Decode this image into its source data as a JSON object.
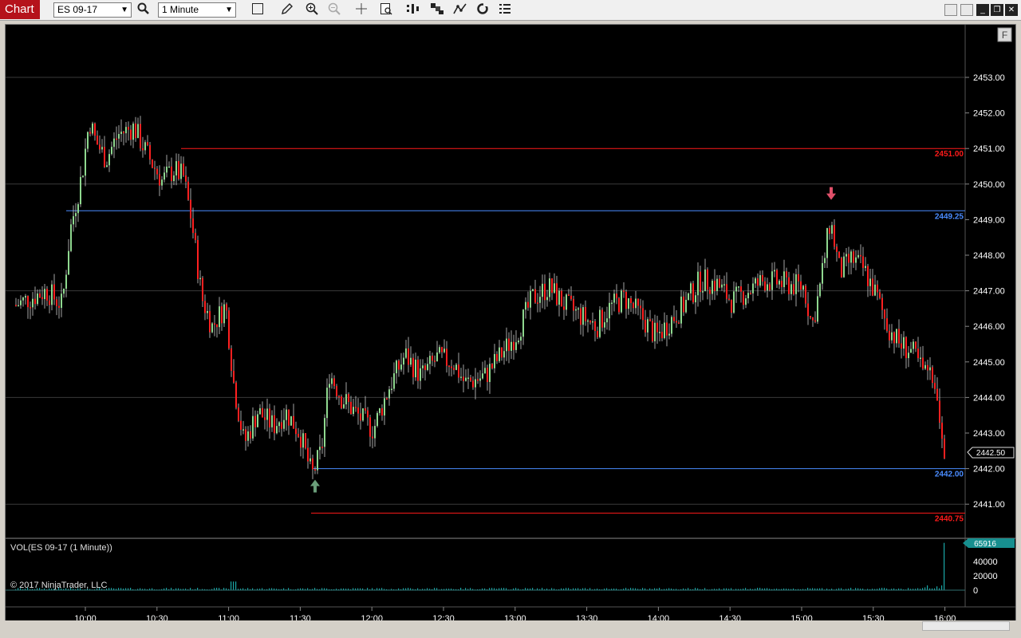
{
  "toolbar": {
    "chart_tab": "Chart",
    "instrument": "ES 09-17",
    "interval": "1 Minute",
    "icons": [
      "instrument-search-icon",
      "bar-style-icon",
      "draw-pencil-icon",
      "zoom-in-icon",
      "zoom-out-icon",
      "crosshair-icon",
      "data-box-icon",
      "strategies-icon",
      "chart-trader-icon",
      "indicators-icon",
      "refresh-icon",
      "properties-icon"
    ]
  },
  "window_buttons": [
    "restore-left",
    "restore-right",
    "minimize",
    "maximize",
    "close"
  ],
  "price_chart": {
    "f_button": "F",
    "price_axis_labels": [
      "2453.00",
      "2452.00",
      "2451.00",
      "2450.00",
      "2449.00",
      "2448.00",
      "2447.00",
      "2446.00",
      "2445.00",
      "2444.00",
      "2443.00",
      "2442.00",
      "2441.00"
    ],
    "level_labels": [
      {
        "text": "2451.00",
        "color": "#ff1a1a"
      },
      {
        "text": "2449.25",
        "color": "#4a8cff"
      },
      {
        "text": "2442.00",
        "color": "#4a8cff"
      },
      {
        "text": "2440.75",
        "color": "#ff1a1a"
      }
    ],
    "last_price": "2442.50",
    "up_color": "#8fd88f",
    "down_color": "#ff2020",
    "signal_up_color": "#6a9e7a",
    "signal_down_color": "#e0506a"
  },
  "volume_panel": {
    "title": "VOL(ES 09-17 (1 Minute))",
    "copyright": "© 2017 NinjaTrader, LLC",
    "axis_labels": [
      "40000",
      "20000",
      "0"
    ],
    "last_volume": "65916",
    "bar_color": "#1aa7a7"
  },
  "time_axis": [
    "10:00",
    "10:30",
    "11:00",
    "11:30",
    "12:00",
    "12:30",
    "13:00",
    "13:30",
    "14:00",
    "14:30",
    "15:00",
    "15:30",
    "16:00"
  ]
}
